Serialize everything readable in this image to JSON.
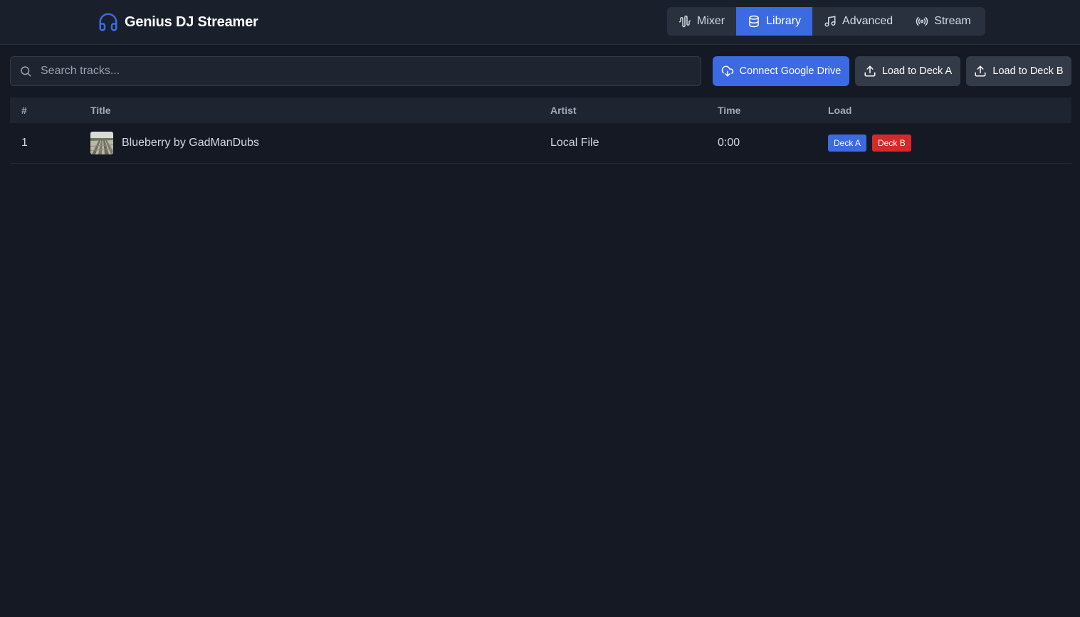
{
  "app": {
    "title": "Genius DJ Streamer",
    "accent_color": "#3b6ae3",
    "danger_color": "#d42a2a"
  },
  "nav": {
    "tabs": [
      {
        "label": "Mixer",
        "icon": "waveform-icon",
        "active": false
      },
      {
        "label": "Library",
        "icon": "database-icon",
        "active": true
      },
      {
        "label": "Advanced",
        "icon": "music-note-icon",
        "active": false
      },
      {
        "label": "Stream",
        "icon": "broadcast-icon",
        "active": false
      }
    ]
  },
  "toolbar": {
    "search_placeholder": "Search tracks...",
    "search_value": "",
    "connect_drive_label": "Connect Google Drive",
    "load_deck_a_label": "Load to Deck A",
    "load_deck_b_label": "Load to Deck B"
  },
  "table": {
    "columns": [
      "#",
      "Title",
      "Artist",
      "Time",
      "Load"
    ],
    "rows": [
      {
        "num": "1",
        "title": "Blueberry by GadManDubs",
        "artist": "Local File",
        "time": "0:00",
        "deck_a_label": "Deck A",
        "deck_b_label": "Deck B"
      }
    ]
  }
}
